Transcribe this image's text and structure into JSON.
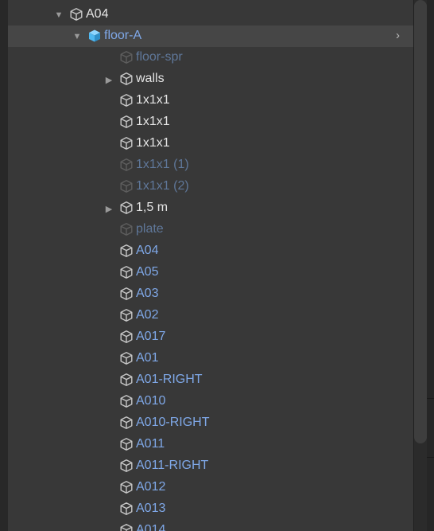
{
  "hierarchy": {
    "items": [
      {
        "label": "A04",
        "arrow": "▼",
        "depth": 0,
        "style": "white",
        "icon": "cube-outline-icon"
      },
      {
        "label": "floor-A",
        "arrow": "▼",
        "depth": 1,
        "style": "blue",
        "icon": "cube-prefab-icon",
        "selected": true,
        "chevron": "›"
      },
      {
        "label": "floor-spr",
        "arrow": "",
        "depth": 2,
        "style": "dim",
        "icon": "cube-outline-icon"
      },
      {
        "label": "walls",
        "arrow": "▶",
        "depth": 2,
        "style": "white",
        "icon": "cube-outline-icon"
      },
      {
        "label": "1x1x1",
        "arrow": "",
        "depth": 2,
        "style": "white",
        "icon": "cube-outline-icon"
      },
      {
        "label": "1x1x1",
        "arrow": "",
        "depth": 2,
        "style": "white",
        "icon": "cube-outline-icon"
      },
      {
        "label": "1x1x1",
        "arrow": "",
        "depth": 2,
        "style": "white",
        "icon": "cube-outline-icon"
      },
      {
        "label": "1x1x1 (1)",
        "arrow": "",
        "depth": 2,
        "style": "dim",
        "icon": "cube-outline-icon"
      },
      {
        "label": "1x1x1 (2)",
        "arrow": "",
        "depth": 2,
        "style": "dim",
        "icon": "cube-outline-icon"
      },
      {
        "label": "1,5 m",
        "arrow": "▶",
        "depth": 2,
        "style": "white",
        "icon": "cube-outline-icon"
      },
      {
        "label": "plate",
        "arrow": "",
        "depth": 2,
        "style": "dim",
        "icon": "cube-outline-icon"
      },
      {
        "label": "A04",
        "arrow": "",
        "depth": 2,
        "style": "blue",
        "icon": "cube-outline-icon"
      },
      {
        "label": "A05",
        "arrow": "",
        "depth": 2,
        "style": "blue",
        "icon": "cube-outline-icon"
      },
      {
        "label": "A03",
        "arrow": "",
        "depth": 2,
        "style": "blue",
        "icon": "cube-outline-icon"
      },
      {
        "label": "A02",
        "arrow": "",
        "depth": 2,
        "style": "blue",
        "icon": "cube-outline-icon"
      },
      {
        "label": "A017",
        "arrow": "",
        "depth": 2,
        "style": "blue",
        "icon": "cube-outline-icon"
      },
      {
        "label": "A01",
        "arrow": "",
        "depth": 2,
        "style": "blue",
        "icon": "cube-outline-icon"
      },
      {
        "label": "A01-RIGHT",
        "arrow": "",
        "depth": 2,
        "style": "blue",
        "icon": "cube-outline-icon"
      },
      {
        "label": "A010",
        "arrow": "",
        "depth": 2,
        "style": "blue",
        "icon": "cube-outline-icon"
      },
      {
        "label": "A010-RIGHT",
        "arrow": "",
        "depth": 2,
        "style": "blue",
        "icon": "cube-outline-icon"
      },
      {
        "label": "A011",
        "arrow": "",
        "depth": 2,
        "style": "blue",
        "icon": "cube-outline-icon"
      },
      {
        "label": "A011-RIGHT",
        "arrow": "",
        "depth": 2,
        "style": "blue",
        "icon": "cube-outline-icon"
      },
      {
        "label": "A012",
        "arrow": "",
        "depth": 2,
        "style": "blue",
        "icon": "cube-outline-icon"
      },
      {
        "label": "A013",
        "arrow": "",
        "depth": 2,
        "style": "blue",
        "icon": "cube-outline-icon"
      },
      {
        "label": "A014",
        "arrow": "",
        "depth": 2,
        "style": "blue",
        "icon": "cube-outline-icon"
      }
    ]
  },
  "colors": {
    "background": "#383838",
    "text_white": "#e4e4e4",
    "text_blue": "#7fa8e8",
    "text_dim": "#5f7799",
    "prefab_icon": "#4fb8f0"
  }
}
